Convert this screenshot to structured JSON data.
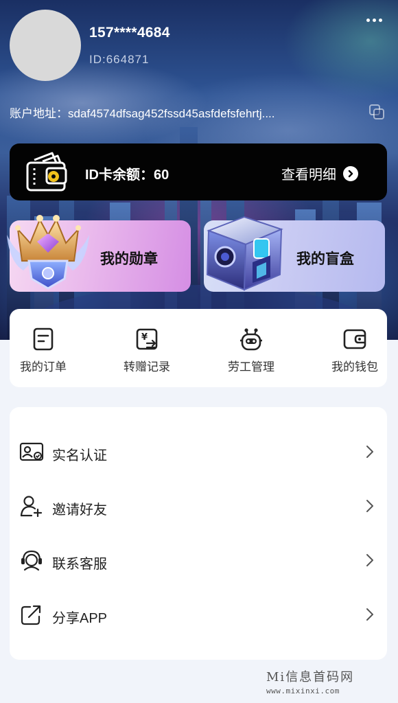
{
  "profile": {
    "phone": "157****4684",
    "id": "ID:664871",
    "address": "账户地址：sdaf4574dfsag452fssd45asfdefsfehrtj...."
  },
  "balance_card": {
    "balance": "ID卡余额：60",
    "detail_label": "查看明细"
  },
  "features": [
    {
      "label": "我的勋章",
      "icon": "medal-crown-icon"
    },
    {
      "label": "我的盲盒",
      "icon": "mystery-box-icon"
    }
  ],
  "quick_actions": [
    {
      "label": "我的订单",
      "icon": "order-icon"
    },
    {
      "label": "转赠记录",
      "icon": "transfer-record-icon"
    },
    {
      "label": "劳工管理",
      "icon": "robot-icon"
    },
    {
      "label": "我的钱包",
      "icon": "wallet-icon"
    }
  ],
  "menu": [
    {
      "label": "实名认证",
      "icon": "id-verify-icon"
    },
    {
      "label": "邀请好友",
      "icon": "invite-friend-icon"
    },
    {
      "label": "联系客服",
      "icon": "customer-service-icon"
    },
    {
      "label": "分享APP",
      "icon": "share-icon"
    }
  ],
  "watermark": {
    "title": "Mi信息首码网",
    "url": "www.mixinxi.com"
  },
  "colors": {
    "card_bg": "#030303",
    "page_bg": "#f1f4fa",
    "medal_gradient_end": "#d58ee4",
    "box_gradient_end": "#b5b9ef"
  }
}
